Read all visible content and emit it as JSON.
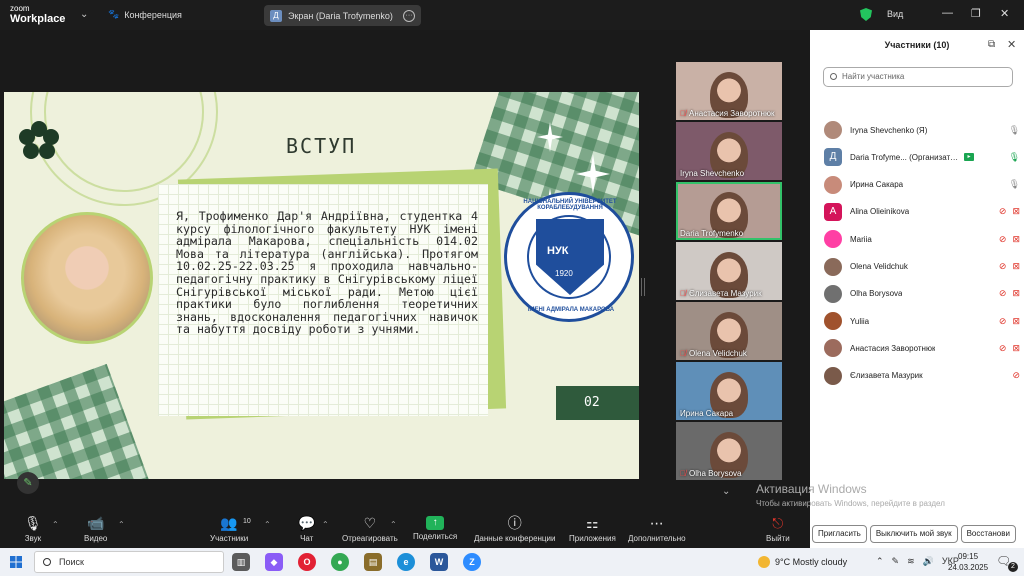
{
  "titlebar": {
    "logo_line1": "zoom",
    "logo_line2": "Workplace",
    "meeting_label": "Конференция",
    "screen_label": "Экран (Daria Trofymenko)",
    "screen_badge": "Д",
    "view_label": "Вид"
  },
  "slide": {
    "title": "ВСТУП",
    "body": "Я, Трофименко Дар'я Андріївна, студентка 4 курсу філологічного факультету НУК імені адмірала Макарова, спеціальність 014.02 Мова та література (англійська). Протягом 10.02.25-22.03.25 я проходила навчально-педагогічну практику в Снігурівському ліцеї Снігурівської міської ради. Метою цієї практики було поглиблення теоретичних знань, вдосконалення педагогічних навичок та набуття досвіду роботи з учнями.",
    "page_number": "02",
    "crest_ring_top": "НАЦІОНАЛЬНИЙ УНІВЕРСИТЕТ КОРАБЛЕБУДУВАННЯ",
    "crest_ring_bottom": "ІМЕНІ АДМІРАЛА МАКАРОВА",
    "crest_abbr": "НУК",
    "crest_year": "1920"
  },
  "video_tiles": [
    {
      "name": "Анастасия Заворотнюк",
      "muted": true,
      "bg": "#c9b1a6"
    },
    {
      "name": "Iryna Shevchenko",
      "muted": false,
      "bg": "#7e5a6a"
    },
    {
      "name": "Daria Trofymenko",
      "muted": false,
      "bg": "#b59c94"
    },
    {
      "name": "Єлизавета Мазурик",
      "muted": true,
      "bg": "#cfc9c5"
    },
    {
      "name": "Olena Velidchuk",
      "muted": true,
      "bg": "#9f8f86"
    },
    {
      "name": "Ирина Сакара",
      "muted": false,
      "bg": "#5f8fb8"
    },
    {
      "name": "Olha Borysova",
      "muted": true,
      "bg": "#6a6a6a"
    }
  ],
  "participants": {
    "title": "Участники (10)",
    "search_placeholder": "Найти участника",
    "list": [
      {
        "name": "Iryna Shevchenko (Я)",
        "avatar": "",
        "color": "#b08a7a",
        "state": "mic"
      },
      {
        "name": "Daria Trofyme... (Организатор)",
        "avatar": "Д",
        "color": "#5e7fa6",
        "state": "host"
      },
      {
        "name": "Ирина Сакара",
        "avatar": "",
        "color": "#c88b7a",
        "state": "mic"
      },
      {
        "name": "Alina Olieinikova",
        "avatar": "A",
        "color": "#d4145a",
        "state": "off"
      },
      {
        "name": "Mariia",
        "avatar": "",
        "color": "#ff3fa4",
        "state": "off"
      },
      {
        "name": "Olena Velidchuk",
        "avatar": "",
        "color": "#8a6a5a",
        "state": "off"
      },
      {
        "name": "Olha Borysova",
        "avatar": "",
        "color": "#707070",
        "state": "off"
      },
      {
        "name": "Yuliia",
        "avatar": "",
        "color": "#a0522d",
        "state": "off"
      },
      {
        "name": "Анастасия Заворотнюк",
        "avatar": "",
        "color": "#9c6b5d",
        "state": "off"
      },
      {
        "name": "Єлизавета Мазурик",
        "avatar": "",
        "color": "#7a5a4a",
        "state": "miconly"
      }
    ],
    "btn_invite": "Пригласить",
    "btn_mute": "Выключить мой звук",
    "btn_restore": "Восстанови"
  },
  "activation": {
    "line1": "Активация Windows",
    "line2": "Чтобы активировать Windows, перейдите в раздел \"Параметры\"."
  },
  "toolbar": {
    "audio": "Звук",
    "video": "Видео",
    "participants": "Участники",
    "participants_count": "10",
    "chat": "Чат",
    "react": "Отреагировать",
    "share": "Поделиться",
    "info": "Данные конференции",
    "apps": "Приложения",
    "more": "Дополнительно",
    "leave": "Выйти"
  },
  "taskbar": {
    "search": "Поиск",
    "weather": "9°C  Mostly cloudy",
    "lang": "УКР",
    "time": "09:15",
    "date": "24.03.2025",
    "notif_count": "2"
  },
  "colors": {
    "accent_green": "#33c26a",
    "mute_red": "#e0352b",
    "slide_dark_green": "#2f5a3c"
  }
}
